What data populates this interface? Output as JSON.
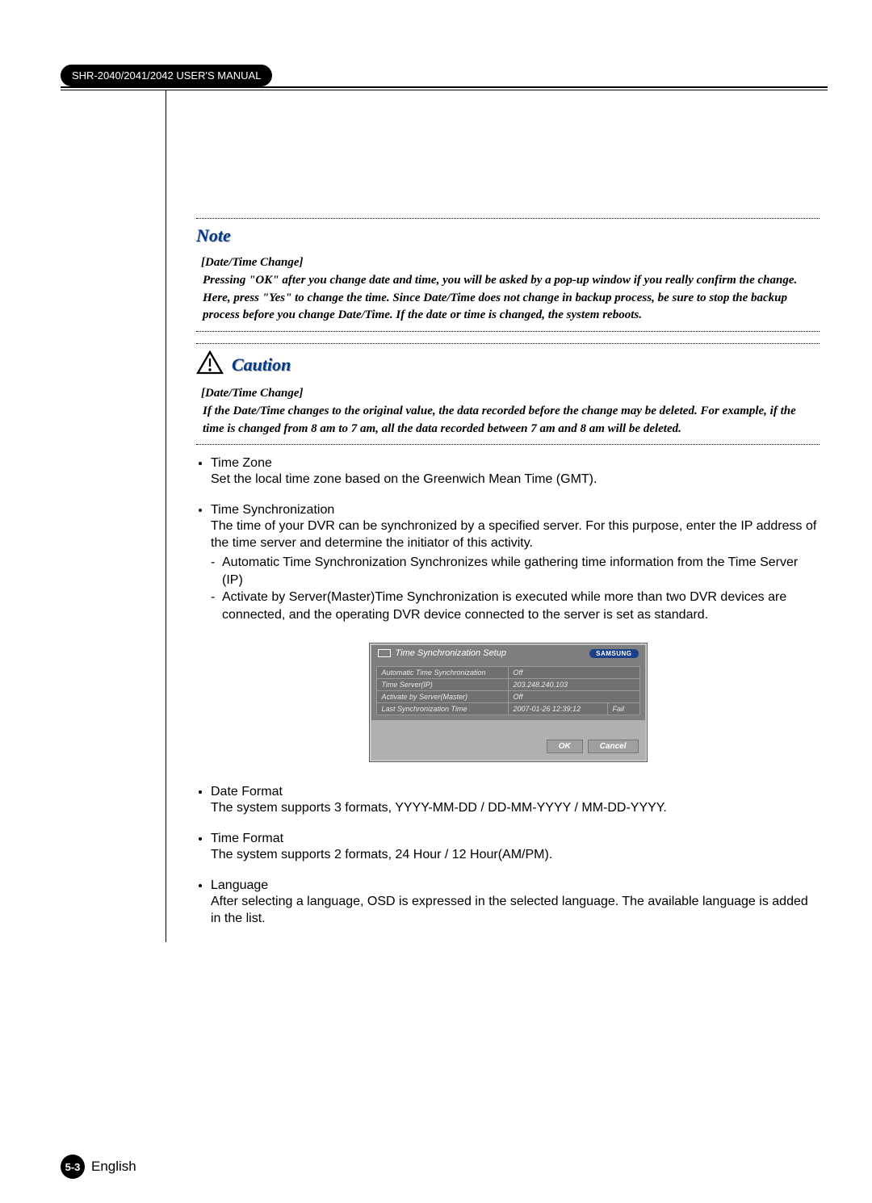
{
  "header": {
    "manual_title": "SHR-2040/2041/2042 USER'S MANUAL"
  },
  "note": {
    "title": "Note",
    "subtitle": "[Date/Time Change]",
    "body": "Pressing \"OK\" after you change date and time, you will be asked by a pop-up window if you really confirm the change. Here, press \"Yes\" to change the time. Since Date/Time does not change in backup process, be sure to stop the backup process before you change Date/Time. If the date or time is changed, the system reboots."
  },
  "caution": {
    "title": "Caution",
    "subtitle": "[Date/Time Change]",
    "body": "If the Date/Time changes to the original value, the data recorded before the change may be deleted. For example, if the time is changed from 8 am to 7 am, all the data recorded between 7 am and 8 am will be deleted."
  },
  "bullets": [
    {
      "title": "Time Zone",
      "desc": "Set the local time zone based on the Greenwich Mean Time (GMT)."
    },
    {
      "title": "Time Synchronization",
      "desc": "The time of your DVR can be synchronized by a specified server. For this purpose, enter the IP address of the time server and determine the initiator of this activity.",
      "sub": [
        "Automatic Time Synchronization Synchronizes while gathering time information from the Time Server (IP)",
        "Activate by Server(Master)Time Synchronization is executed while more than two DVR devices are connected, and the operating DVR device connected to the server is set as standard."
      ]
    },
    {
      "title": "Date Format",
      "desc": "The system supports 3 formats, YYYY-MM-DD / DD-MM-YYYY / MM-DD-YYYY."
    },
    {
      "title": "Time Format",
      "desc": "The system supports 2 formats, 24 Hour / 12 Hour(AM/PM)."
    },
    {
      "title": "Language",
      "desc": "After selecting a language, OSD is expressed in the selected language. The available language is added in the list."
    }
  ],
  "dialog": {
    "title": "Time Synchronization Setup",
    "brand": "SAMSUNG",
    "rows": {
      "auto_label": "Automatic Time Synchronization",
      "auto_value": "Off",
      "server_label": "Time Server(IP)",
      "server_value": "203.248.240.103",
      "activate_label": "Activate by Server(Master)",
      "activate_value": "Off",
      "last_label": "Last Synchronization Time",
      "last_value": "2007-01-26 12:39:12",
      "last_status": "Fail"
    },
    "ok": "OK",
    "cancel": "Cancel"
  },
  "footer": {
    "page": "5-3",
    "lang": "English"
  }
}
